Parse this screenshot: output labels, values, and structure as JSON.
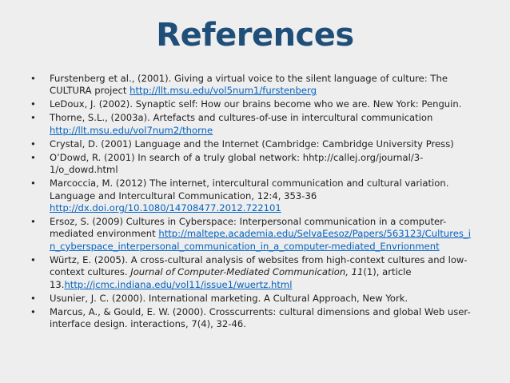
{
  "title": "References",
  "bullet": "•",
  "references": [
    {
      "text": "Furstenberg et al., (2001). Giving a virtual voice to the silent language of culture: The CULTURA project ",
      "link": "http://llt.msu.edu/vol5num1/furstenberg"
    },
    {
      "text": "LeDoux, J. (2002). Synaptic self: How our brains become who we are. New York: Penguin."
    },
    {
      "text": "Thorne, S.L., (2003a). Artefacts and cultures-of-use in intercultural communication ",
      "link": "http://llt.msu.edu/vol7num2/thorne"
    },
    {
      "text": "Crystal, D. (2001) Language and the Internet (Cambridge: Cambridge University Press)"
    },
    {
      "text": "O’Dowd, R. (2001) In search of a truly global network: hhtp://callej.org/journal/3-1/o_dowd.html"
    },
    {
      "text": "Marcoccia, M. (2012) The internet, intercultural communication and cultural variation. Language and Intercultural Communication, 12:4, 353-36 ",
      "link": "http://dx.doi.org/10.1080/14708477.2012.722101"
    },
    {
      "text": "Ersoz, S. (2009) Cultures in Cyberspace: Interpersonal communication in a computer-mediated environment ",
      "link": "http://maltepe.academia.edu/SelvaEesoz/Papers/563123/Cultures_in_cyberspace_interpersonal_communication_in_a_computer-mediated_Envrionment"
    },
    {
      "text": "Würtz, E. (2005). A cross-cultural analysis of websites from high-context cultures and low-context cultures. ",
      "italic": "Journal of Computer-Mediated Communication, 11",
      "text2": "(1), article 13.",
      "link": "http://jcmc.indiana.edu/vol11/issue1/wuertz.html"
    },
    {
      "text": "Usunier, J. C. (2000). International marketing. A Cultural Approach, New York."
    },
    {
      "text": "Marcus, A., & Gould, E. W. (2000). Crosscurrents: cultural dimensions and global Web user-interface design. interactions, 7(4), 32-46."
    }
  ]
}
